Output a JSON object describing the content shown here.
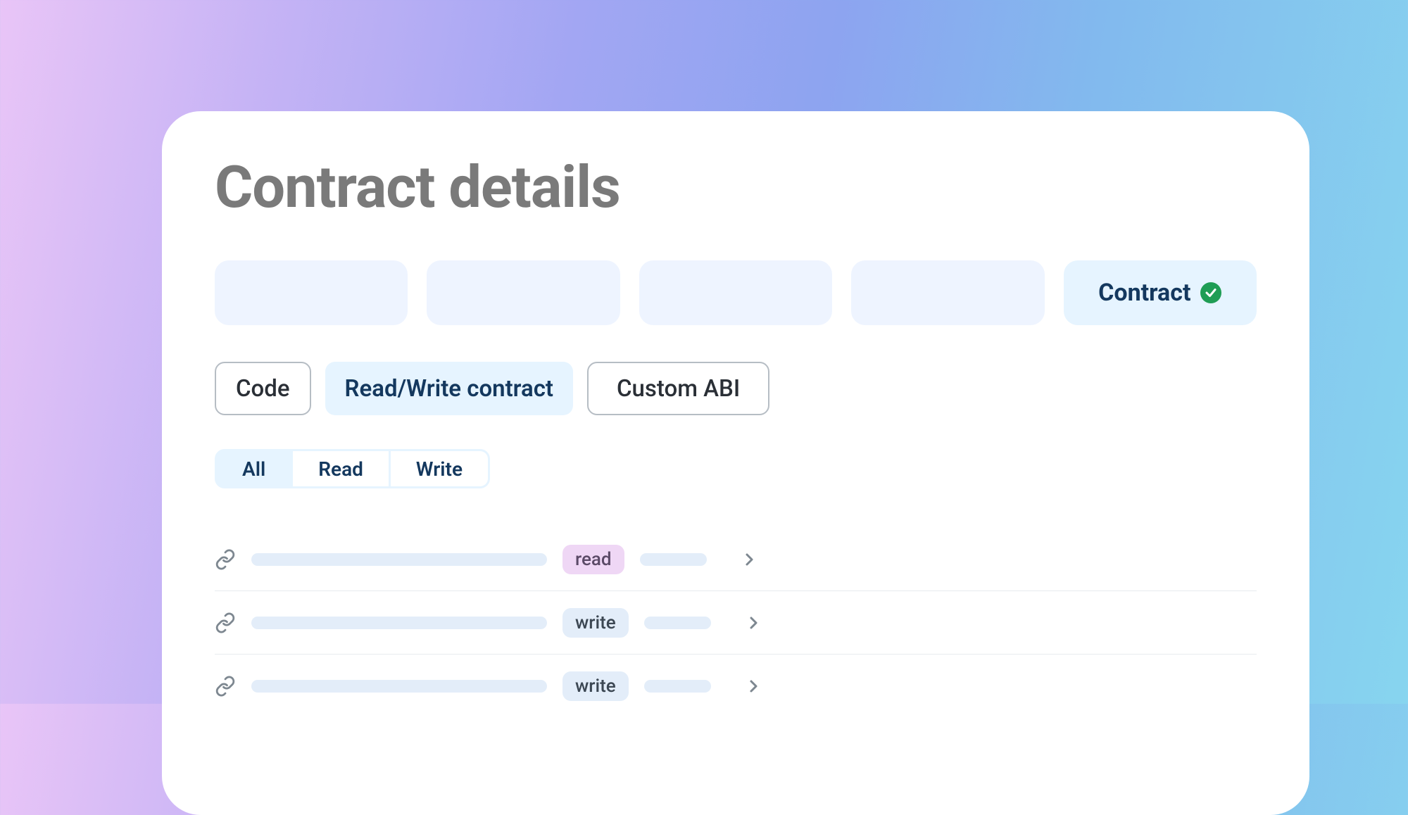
{
  "title": "Contract details",
  "topTabs": {
    "contract_label": "Contract"
  },
  "subtabs": {
    "code": "Code",
    "rw": "Read/Write contract",
    "custom": "Custom ABI"
  },
  "filters": {
    "all": "All",
    "read": "Read",
    "write": "Write"
  },
  "methods": [
    {
      "tag": "read",
      "tag_class": "read"
    },
    {
      "tag": "write",
      "tag_class": "write"
    },
    {
      "tag": "write",
      "tag_class": "write"
    }
  ]
}
